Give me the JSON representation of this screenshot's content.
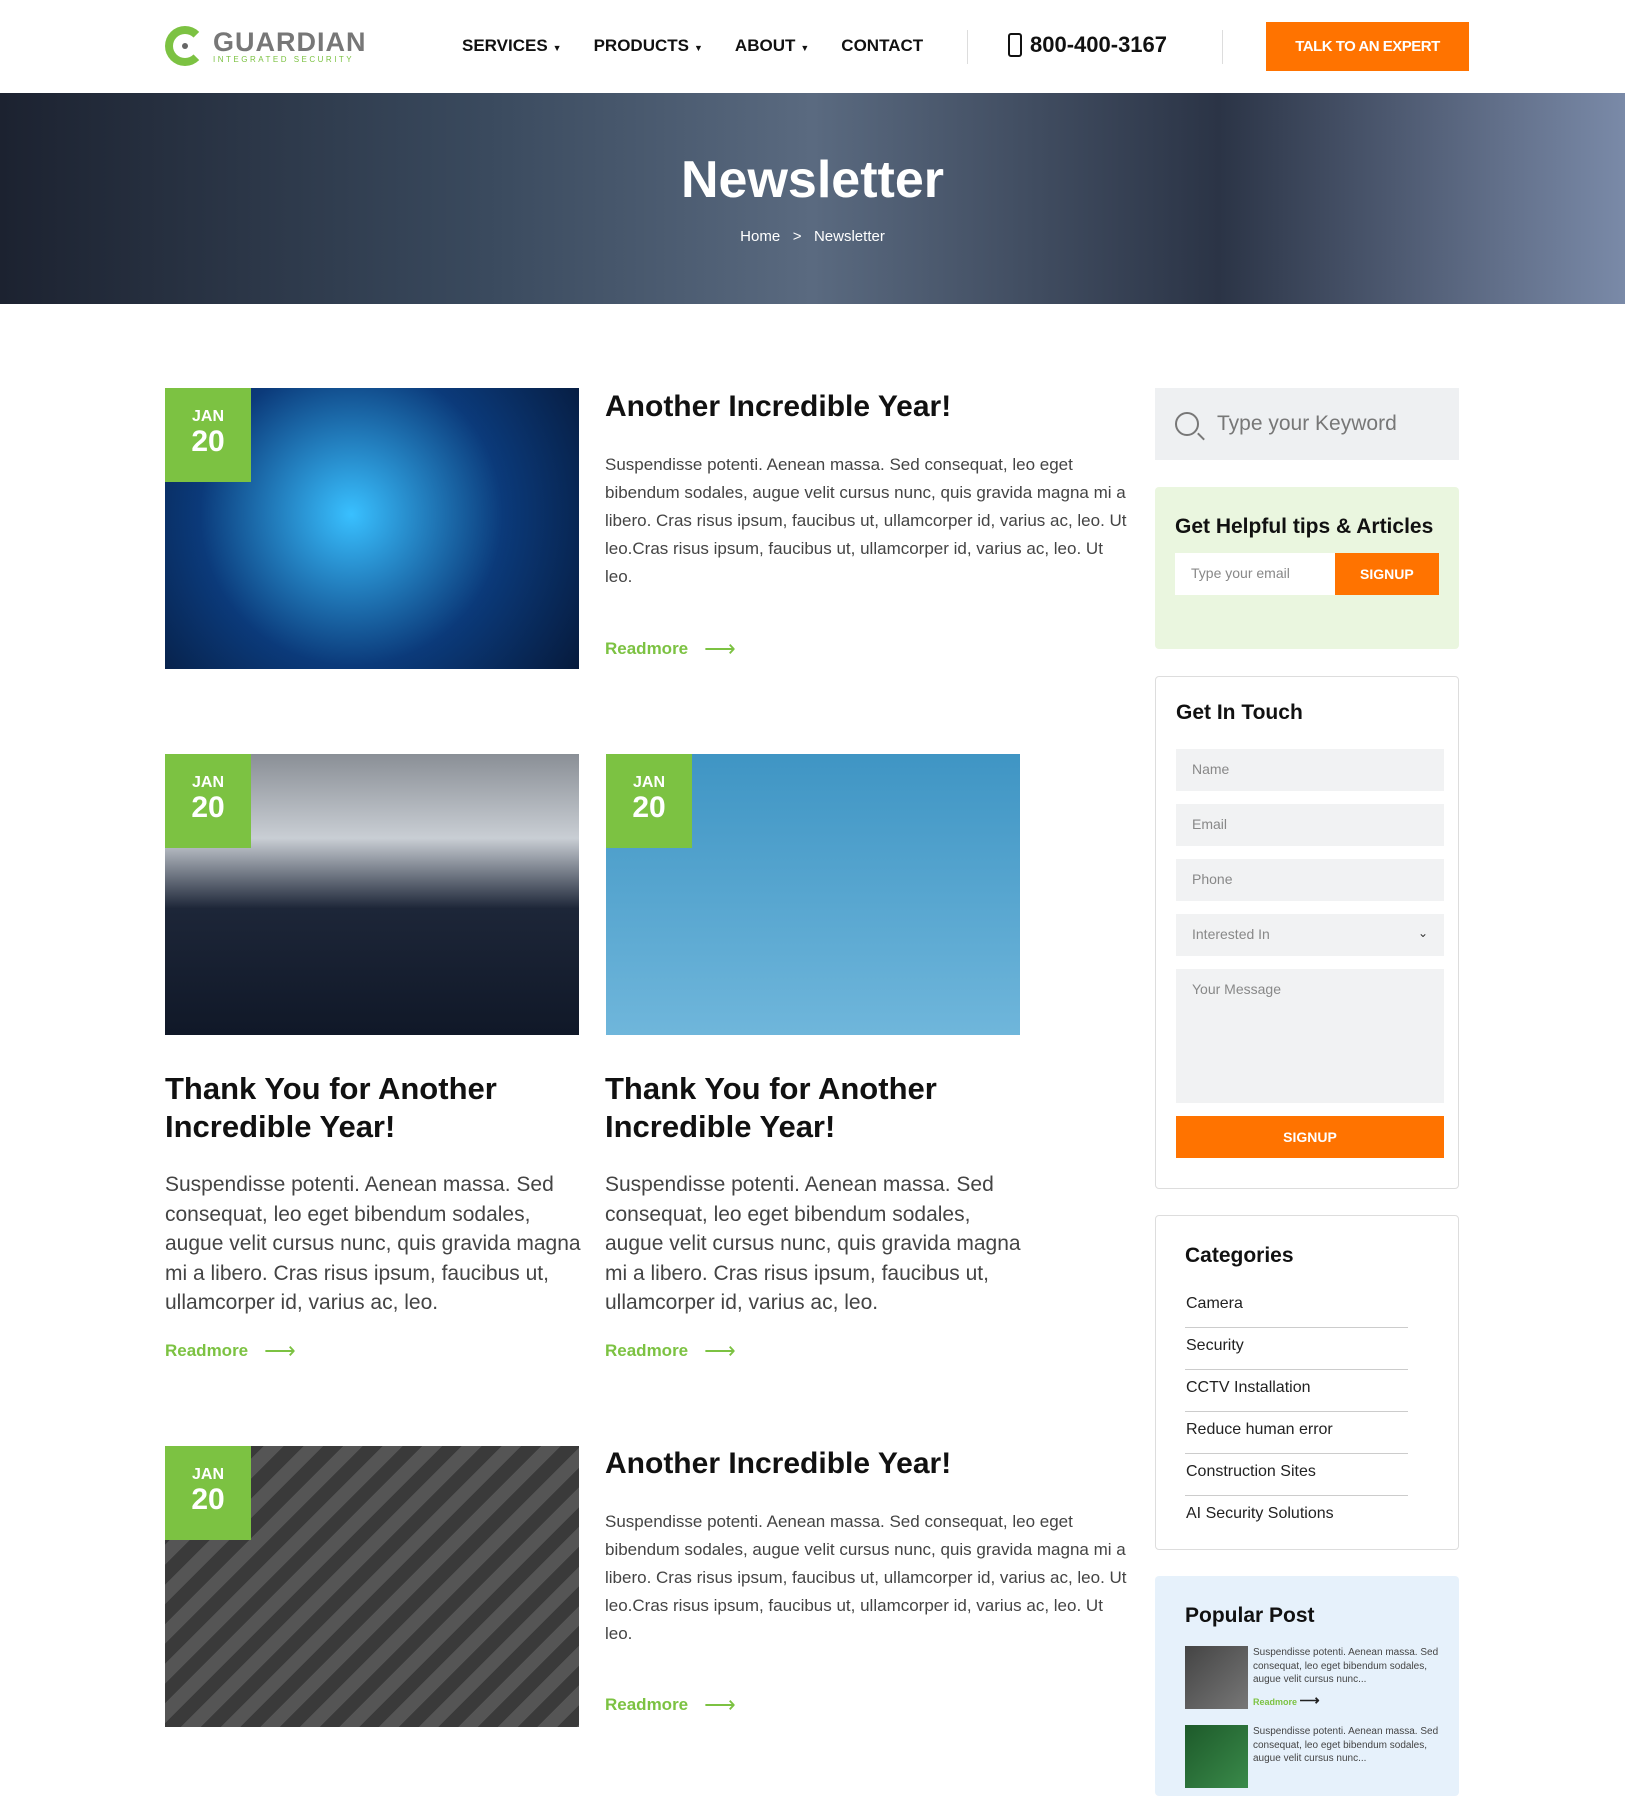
{
  "header": {
    "logo_name": "GUARDIAN",
    "logo_sub": "INTEGRATED SECURITY",
    "nav": [
      {
        "label": "SERVICES",
        "dropdown": true
      },
      {
        "label": "PRODUCTS",
        "dropdown": true
      },
      {
        "label": "ABOUT",
        "dropdown": true
      },
      {
        "label": "CONTACT",
        "dropdown": false
      }
    ],
    "phone": "800-400-3167",
    "cta": "TALK TO AN EXPERT"
  },
  "hero": {
    "title": "Newsletter",
    "breadcrumb": [
      "Home",
      ">",
      "Newsletter"
    ]
  },
  "posts": [
    {
      "month": "JAN",
      "day": "20",
      "title": "Another Incredible Year!",
      "body": "Suspendisse potenti. Aenean massa. Sed consequat, leo eget bibendum sodales, augue velit cursus nunc, quis gravida magna mi a libero. Cras risus ipsum, faucibus ut, ullamcorper id, varius ac, leo. Ut leo.Cras risus ipsum, faucibus ut, ullamcorper id, varius ac, leo. Ut leo.",
      "readmore": "Readmore"
    },
    {
      "month": "JAN",
      "day": "20",
      "title": "Thank You for Another Incredible Year!",
      "body": "Suspendisse potenti. Aenean massa. Sed consequat, leo eget bibendum sodales, augue velit cursus nunc, quis gravida magna mi a libero. Cras risus ipsum, faucibus ut, ullamcorper id, varius ac, leo.",
      "readmore": "Readmore"
    },
    {
      "month": "JAN",
      "day": "20",
      "title": "Thank You for Another Incredible Year!",
      "body": "Suspendisse potenti. Aenean massa. Sed consequat, leo eget bibendum sodales, augue velit cursus nunc, quis gravida magna mi a libero. Cras risus ipsum, faucibus ut, ullamcorper id, varius ac, leo.",
      "readmore": "Readmore"
    },
    {
      "month": "JAN",
      "day": "20",
      "title": "Another Incredible Year!",
      "body": "Suspendisse potenti. Aenean massa. Sed consequat, leo eget bibendum sodales, augue velit cursus nunc, quis gravida magna mi a libero. Cras risus ipsum, faucibus ut, ullamcorper id, varius ac, leo. Ut leo.Cras risus ipsum, faucibus ut, ullamcorper id, varius ac, leo. Ut leo.",
      "readmore": "Readmore"
    }
  ],
  "sidebar": {
    "search_placeholder": "Type your Keyword",
    "tips": {
      "title": "Get Helpful tips & Articles",
      "email_placeholder": "Type your email",
      "button": "SIGNUP"
    },
    "touch": {
      "title": "Get In Touch",
      "name": "Name",
      "email": "Email",
      "phone": "Phone",
      "interested": "Interested In",
      "message": "Your Message",
      "button": "SIGNUP"
    },
    "categories": {
      "title": "Categories",
      "items": [
        "Camera",
        "Security",
        "CCTV Installation",
        "Reduce human error",
        "Construction Sites",
        "AI Security Solutions"
      ]
    },
    "popular": {
      "title": "Popular Post",
      "items": [
        {
          "text": "Suspendisse potenti. Aenean massa. Sed consequat, leo eget bibendum sodales, augue velit cursus nunc...",
          "readmore": "Readmore"
        },
        {
          "text": "Suspendisse potenti. Aenean massa. Sed consequat, leo eget bibendum sodales, augue velit cursus nunc..."
        }
      ]
    }
  },
  "colors": {
    "accent_orange": "#ff7300",
    "accent_green": "#7cc242"
  }
}
